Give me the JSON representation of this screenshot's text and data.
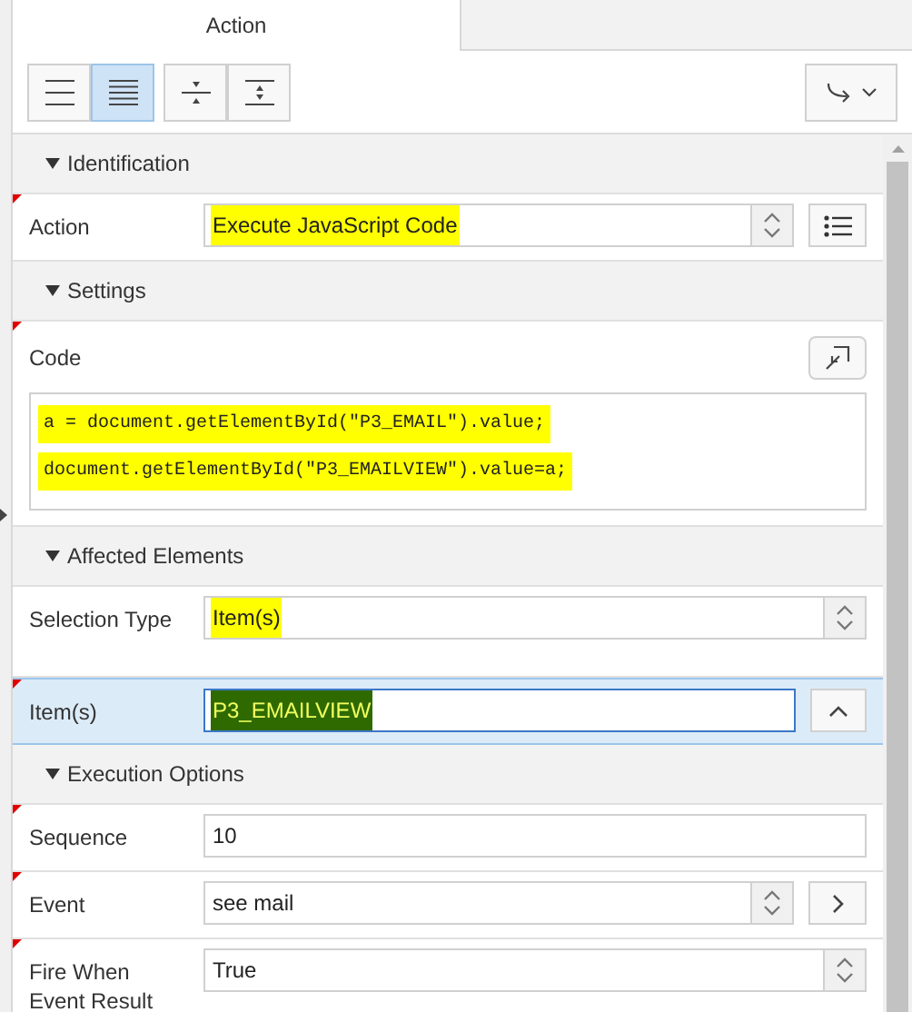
{
  "tabs": [
    {
      "label": "Action",
      "selected": true
    }
  ],
  "toolbar": {
    "view_buttons": [
      {
        "selected": false
      },
      {
        "selected": true
      }
    ],
    "expand_buttons": [
      {
        "selected": false
      },
      {
        "selected": false
      }
    ]
  },
  "sections": [
    {
      "title": "Identification",
      "expanded": true,
      "properties": [
        {
          "kind": "selectlist",
          "label": "Action",
          "value": "Execute JavaScript Code",
          "required": true,
          "highlighted": true
        }
      ]
    },
    {
      "title": "Settings",
      "expanded": true,
      "properties": [
        {
          "kind": "code",
          "label": "Code",
          "required": true,
          "lines": [
            {
              "text": "a = document.getElementById(\"P3_EMAIL\").value;",
              "highlighted": true
            },
            {
              "text": "document.getElementById(\"P3_EMAILVIEW\").value=a;",
              "highlighted": true
            }
          ]
        }
      ]
    },
    {
      "title": "Affected Elements",
      "expanded": true,
      "properties": [
        {
          "kind": "select",
          "label": "Selection Type",
          "value": "Item(s)",
          "required": false,
          "highlighted": true
        },
        {
          "kind": "popup",
          "label": "Item(s)",
          "value": "P3_EMAILVIEW",
          "required": true,
          "highlighted": true,
          "selected": true
        }
      ]
    },
    {
      "title": "Execution Options",
      "expanded": true,
      "properties": [
        {
          "kind": "text",
          "label": "Sequence",
          "value": "10",
          "required": true,
          "highlighted": false
        },
        {
          "kind": "selectlink",
          "label": "Event",
          "value": "see mail",
          "required": true,
          "highlighted": false
        },
        {
          "kind": "select",
          "label": "Fire When Event Result",
          "value": "True",
          "required": true,
          "highlighted": false
        }
      ]
    }
  ]
}
